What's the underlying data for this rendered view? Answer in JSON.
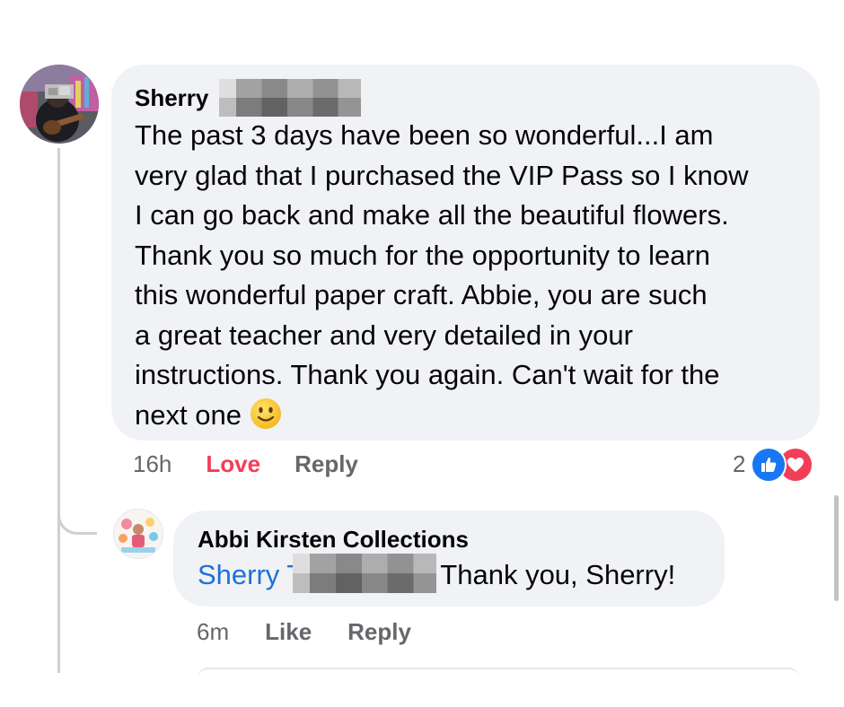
{
  "comment": {
    "author": "Sherry",
    "text_lines": [
      "The past 3 days have been so wonderful...I am",
      "very glad that I purchased the VIP Pass so I know",
      "I can go back and make all the beautiful flowers.",
      "Thank you  so much for the opportunity to learn",
      "this wonderful paper craft.  Abbie, you are such",
      "a great teacher and very detailed in your",
      "instructions. Thank you again.  Can't wait for the"
    ],
    "last_line_text": "next one",
    "emoji": "slightly-smiling-face-icon",
    "time": "16h",
    "love_label": "Love",
    "reply_label": "Reply",
    "reaction_count": "2",
    "reaction_icons": [
      "like-icon",
      "love-icon"
    ]
  },
  "reply": {
    "author": "Abbi Kirsten Collections",
    "mention": "Sherry T",
    "text": "Thank you, Sherry!",
    "time": "6m",
    "like_label": "Like",
    "reply_label": "Reply"
  },
  "colors": {
    "bubble": "#f0f2f5",
    "love": "#f33e58",
    "like_blue": "#1877f2",
    "mention": "#216fdb",
    "meta_gray": "#65676b"
  }
}
